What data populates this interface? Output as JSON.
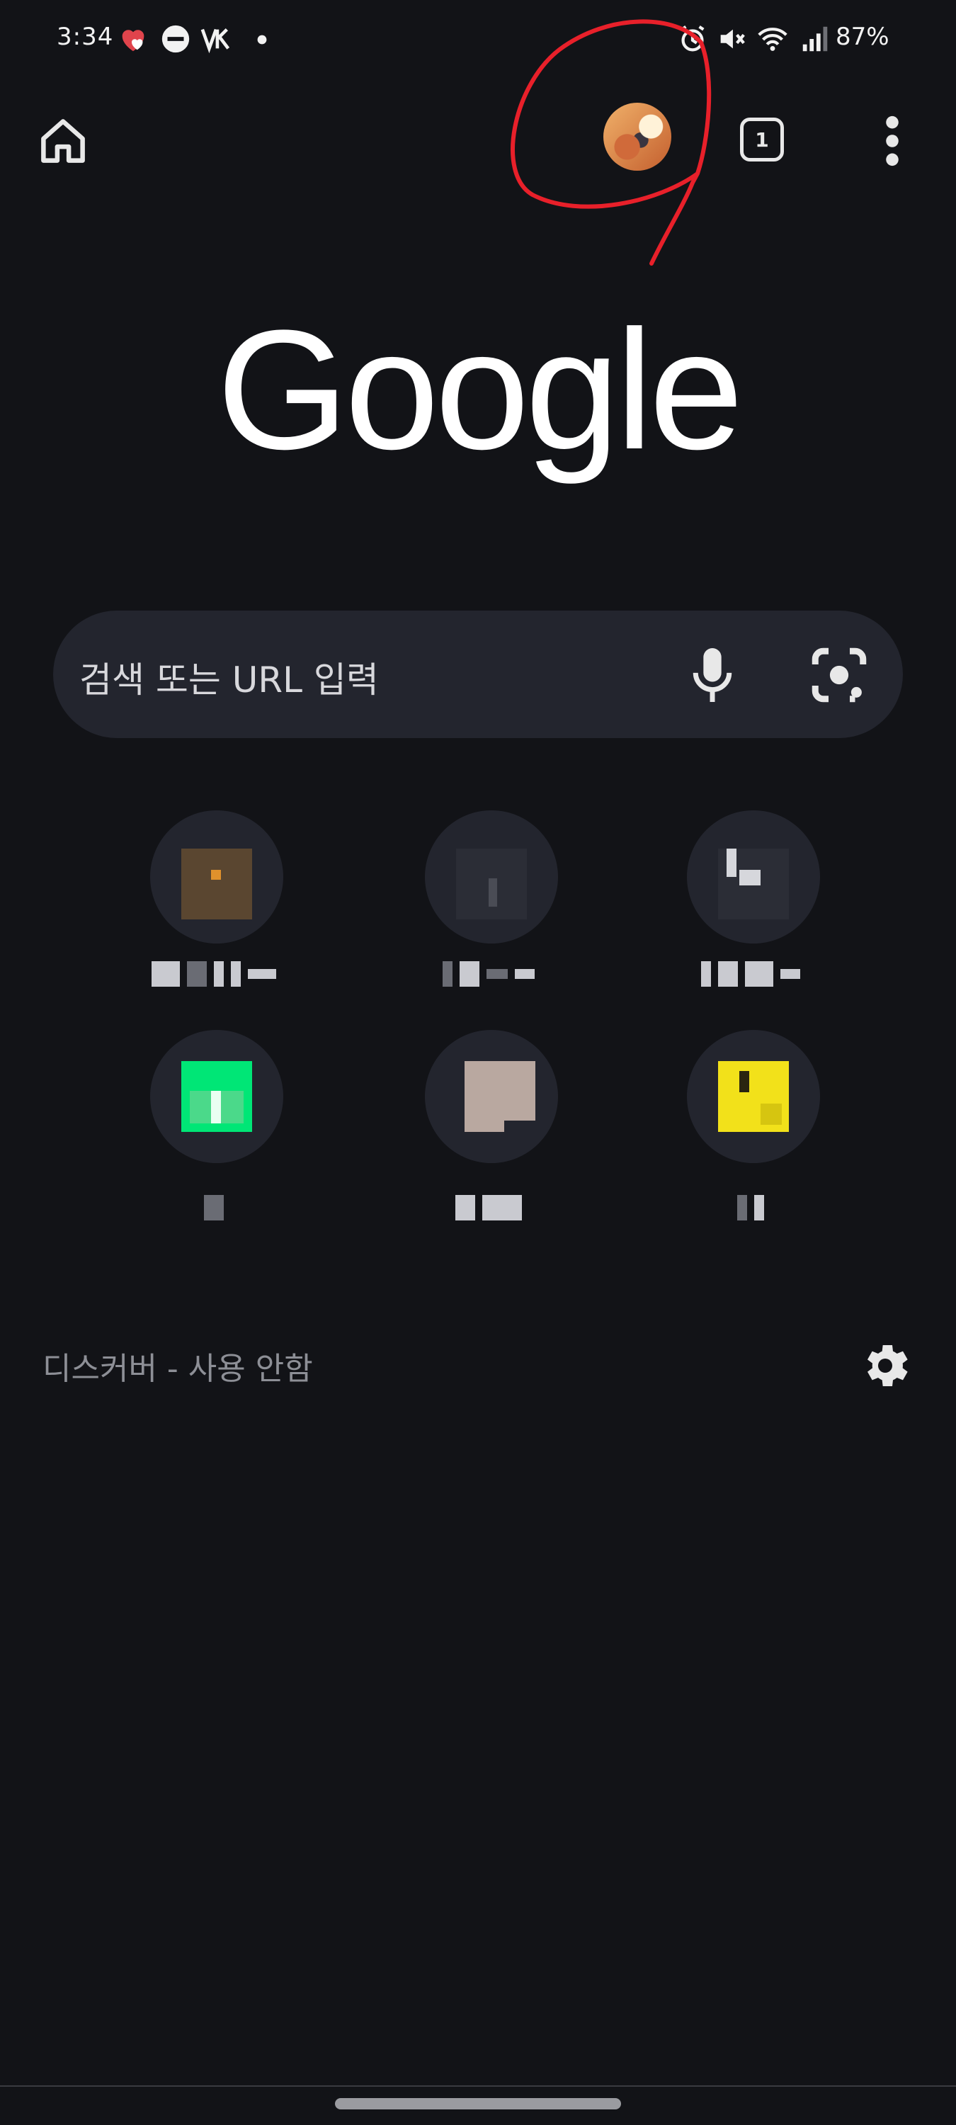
{
  "status_bar": {
    "time": "3:34",
    "battery": "87%"
  },
  "toolbar": {
    "tab_count": "1"
  },
  "logo": {
    "text": "Google"
  },
  "search": {
    "placeholder": "검색 또는 URL 입력"
  },
  "shortcuts": [
    {
      "favicon_color": "#5a4630"
    },
    {
      "favicon_color": "#2b2d36"
    },
    {
      "favicon_color": "#2b2d36"
    },
    {
      "favicon_color": "#00e676"
    },
    {
      "favicon_color": "#b9a8a0"
    },
    {
      "favicon_color": "#f2e11a"
    }
  ],
  "discover": {
    "label": "디스커버 - 사용 안함"
  },
  "colors": {
    "background": "#121317",
    "search_bar": "#23252e",
    "annotation": "#e8202a"
  }
}
